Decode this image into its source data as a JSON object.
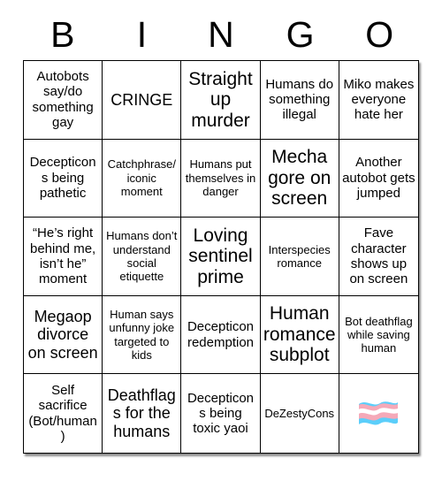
{
  "header": {
    "letters": [
      "B",
      "I",
      "N",
      "G",
      "O"
    ]
  },
  "grid": {
    "rows": 5,
    "columns": 5,
    "border_color": "#000000",
    "background": "#ffffff",
    "cells": [
      {
        "text": "Autobots say/do something gay",
        "size": "fs-md"
      },
      {
        "text": "CRINGE",
        "size": "fs-lg"
      },
      {
        "text": "Straight up murder",
        "size": "fs-xl"
      },
      {
        "text": "Humans do something illegal",
        "size": "fs-md"
      },
      {
        "text": "Miko makes everyone hate her",
        "size": "fs-md"
      },
      {
        "text": "Decepticons being pathetic",
        "size": "fs-md"
      },
      {
        "text": "Catchphrase/ iconic moment",
        "size": "fs-sm"
      },
      {
        "text": "Humans put themselves in danger",
        "size": "fs-sm"
      },
      {
        "text": "Mecha gore on screen",
        "size": "fs-xl"
      },
      {
        "text": "Another autobot gets jumped",
        "size": "fs-md"
      },
      {
        "text": "“He’s right behind me, isn’t he” moment",
        "size": "fs-md"
      },
      {
        "text": "Humans don’t understand social etiquette",
        "size": "fs-sm"
      },
      {
        "text": "Loving sentinel prime",
        "size": "fs-xl"
      },
      {
        "text": "Interspecies romance",
        "size": "fs-sm"
      },
      {
        "text": "Fave character shows up on screen",
        "size": "fs-md"
      },
      {
        "text": "Megaop divorce on screen",
        "size": "fs-lg"
      },
      {
        "text": "Human says unfunny joke targeted to kids",
        "size": "fs-sm"
      },
      {
        "text": "Decepticon redemption",
        "size": "fs-md"
      },
      {
        "text": "Human romance subplot",
        "size": "fs-xl"
      },
      {
        "text": "Bot deathflag while saving human",
        "size": "fs-sm"
      },
      {
        "text": "Self sacrifice (Bot/human)",
        "size": "fs-md"
      },
      {
        "text": "Deathflags for the humans",
        "size": "fs-lg"
      },
      {
        "text": "Decepticons being toxic yaoi",
        "size": "fs-md"
      },
      {
        "text": "DeZestyCons",
        "size": "fs-sm"
      },
      {
        "text": "",
        "size": "flag-cell",
        "icon": "transgender-pride-flag-emoji"
      }
    ]
  },
  "colors": {
    "flag_blue": "#5BCEFA",
    "flag_pink": "#F5A9B8",
    "flag_white": "#FFFFFF",
    "text": "#000000",
    "border": "#000000"
  }
}
